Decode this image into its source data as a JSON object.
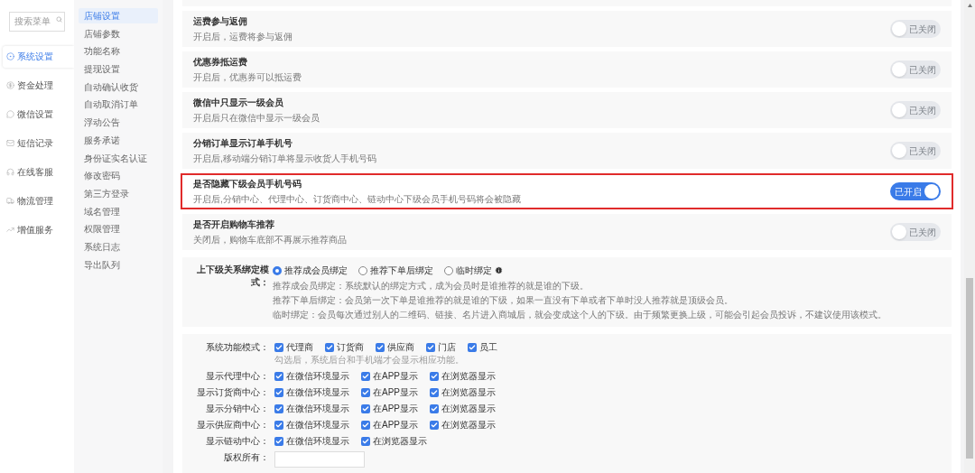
{
  "search": {
    "placeholder": "搜索菜单"
  },
  "nav": [
    {
      "label": "系统设置",
      "selected": true
    },
    {
      "label": "资金处理",
      "selected": false
    },
    {
      "label": "微信设置",
      "selected": false
    },
    {
      "label": "短信记录",
      "selected": false
    },
    {
      "label": "在线客服",
      "selected": false
    },
    {
      "label": "物流管理",
      "selected": false
    },
    {
      "label": "增值服务",
      "selected": false
    }
  ],
  "submenu": [
    {
      "label": "店铺设置",
      "selected": true
    },
    {
      "label": "店铺参数",
      "selected": false
    },
    {
      "label": "功能名称",
      "selected": false
    },
    {
      "label": "提现设置",
      "selected": false
    },
    {
      "label": "自动确认收货",
      "selected": false
    },
    {
      "label": "自动取消订单",
      "selected": false
    },
    {
      "label": "浮动公告",
      "selected": false
    },
    {
      "label": "服务承诺",
      "selected": false
    },
    {
      "label": "身份证实名认证",
      "selected": false
    },
    {
      "label": "修改密码",
      "selected": false
    },
    {
      "label": "第三方登录",
      "selected": false
    },
    {
      "label": "域名管理",
      "selected": false
    },
    {
      "label": "权限管理",
      "selected": false
    },
    {
      "label": "系统日志",
      "selected": false
    },
    {
      "label": "导出队列",
      "selected": false
    }
  ],
  "settings": [
    {
      "title": "运费参与返佣",
      "description": "开启后，运费将参与返佣",
      "on": false,
      "switch_label": "已关闭",
      "highlighted": false
    },
    {
      "title": "优惠券抵运费",
      "description": "开启后，优惠券可以抵运费",
      "on": false,
      "switch_label": "已关闭",
      "highlighted": false
    },
    {
      "title": "微信中只显示一级会员",
      "description": "开启后只在微信中显示一级会员",
      "on": false,
      "switch_label": "已关闭",
      "highlighted": false
    },
    {
      "title": "分销订单显示订单手机号",
      "description": "开启后,移动端分销订单将显示收货人手机号码",
      "on": false,
      "switch_label": "已关闭",
      "highlighted": false
    },
    {
      "title": "是否隐藏下级会员手机号码",
      "description": "开启后,分销中心、代理中心、订货商中心、链动中心下级会员手机号码将会被隐藏",
      "on": true,
      "switch_label": "已开启",
      "highlighted": true
    },
    {
      "title": "是否开启购物车推荐",
      "description": "关闭后，购物车底部不再展示推荐商品",
      "on": false,
      "switch_label": "已关闭",
      "highlighted": false
    }
  ],
  "binding": {
    "label": "上下级关系绑定模式：",
    "options": [
      {
        "label": "推荐成会员绑定",
        "selected": true,
        "info": false
      },
      {
        "label": "推荐下单后绑定",
        "selected": false,
        "info": false
      },
      {
        "label": "临时绑定",
        "selected": false,
        "info": true
      }
    ],
    "notes": [
      "推荐成会员绑定：系统默认的绑定方式，成为会员时是谁推荐的就是谁的下级。",
      "推荐下单后绑定：会员第一次下单是谁推荐的就是谁的下级，如果一直没有下单或者下单时没人推荐就是顶级会员。",
      "临时绑定：会员每次通过别人的二维码、链接、名片进入商城后，就会变成这个人的下级。由于频繁更换上级，可能会引起会员投诉，不建议使用该模式。"
    ]
  },
  "functions": [
    {
      "label": "系统功能模式：",
      "hint": "勾选后，系统后台和手机端才会显示相应功能。",
      "options": [
        {
          "label": "代理商",
          "checked": true
        },
        {
          "label": "订货商",
          "checked": true
        },
        {
          "label": "供应商",
          "checked": true
        },
        {
          "label": "门店",
          "checked": true
        },
        {
          "label": "员工",
          "checked": true
        }
      ]
    },
    {
      "label": "显示代理中心：",
      "options": [
        {
          "label": "在微信环境显示",
          "checked": true
        },
        {
          "label": "在APP显示",
          "checked": true
        },
        {
          "label": "在浏览器显示",
          "checked": true
        }
      ]
    },
    {
      "label": "显示订货商中心：",
      "options": [
        {
          "label": "在微信环境显示",
          "checked": true
        },
        {
          "label": "在APP显示",
          "checked": true
        },
        {
          "label": "在浏览器显示",
          "checked": true
        }
      ]
    },
    {
      "label": "显示分销中心：",
      "options": [
        {
          "label": "在微信环境显示",
          "checked": true
        },
        {
          "label": "在APP显示",
          "checked": true
        },
        {
          "label": "在浏览器显示",
          "checked": true
        }
      ]
    },
    {
      "label": "显示供应商中心：",
      "options": [
        {
          "label": "在微信环境显示",
          "checked": true
        },
        {
          "label": "在APP显示",
          "checked": true
        },
        {
          "label": "在浏览器显示",
          "checked": true
        }
      ]
    },
    {
      "label": "显示链动中心：",
      "options": [
        {
          "label": "在微信环境显示",
          "checked": true
        },
        {
          "label": "在浏览器显示",
          "checked": true
        }
      ]
    }
  ],
  "copyright": {
    "label": "版权所有："
  }
}
